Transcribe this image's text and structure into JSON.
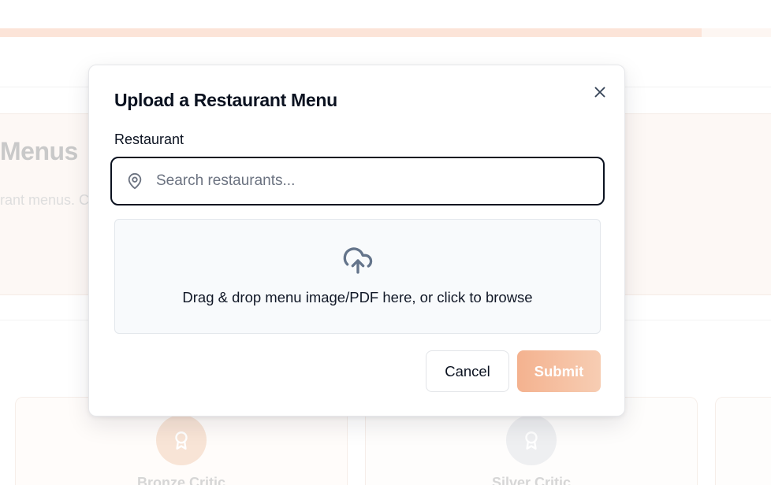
{
  "background": {
    "progress_fraction": 0.91,
    "hero": {
      "title_fragment": "Menus",
      "subtitle_fragment": "rant menus. C"
    },
    "cards": [
      {
        "label": "Bronze Critic",
        "badge_icon": "award-icon",
        "badge_color": "#f8e4d6"
      },
      {
        "label": "Silver Critic",
        "badge_icon": "award-icon",
        "badge_color": "#eeeff1"
      }
    ]
  },
  "modal": {
    "title": "Upload a Restaurant Menu",
    "close_icon": "close-icon",
    "restaurant_field": {
      "label": "Restaurant",
      "icon": "map-pin-icon",
      "placeholder": "Search restaurants...",
      "value": ""
    },
    "dropzone": {
      "icon": "cloud-upload-icon",
      "text": "Drag & drop menu image/PDF here, or click to browse"
    },
    "buttons": {
      "cancel": "Cancel",
      "submit": "Submit"
    }
  },
  "colors": {
    "accent": "#f4b28f",
    "accent_light": "#f7cdb3",
    "text_primary": "#0b1220",
    "placeholder": "#6b7280",
    "dropzone_bg": "#f8fafc"
  }
}
